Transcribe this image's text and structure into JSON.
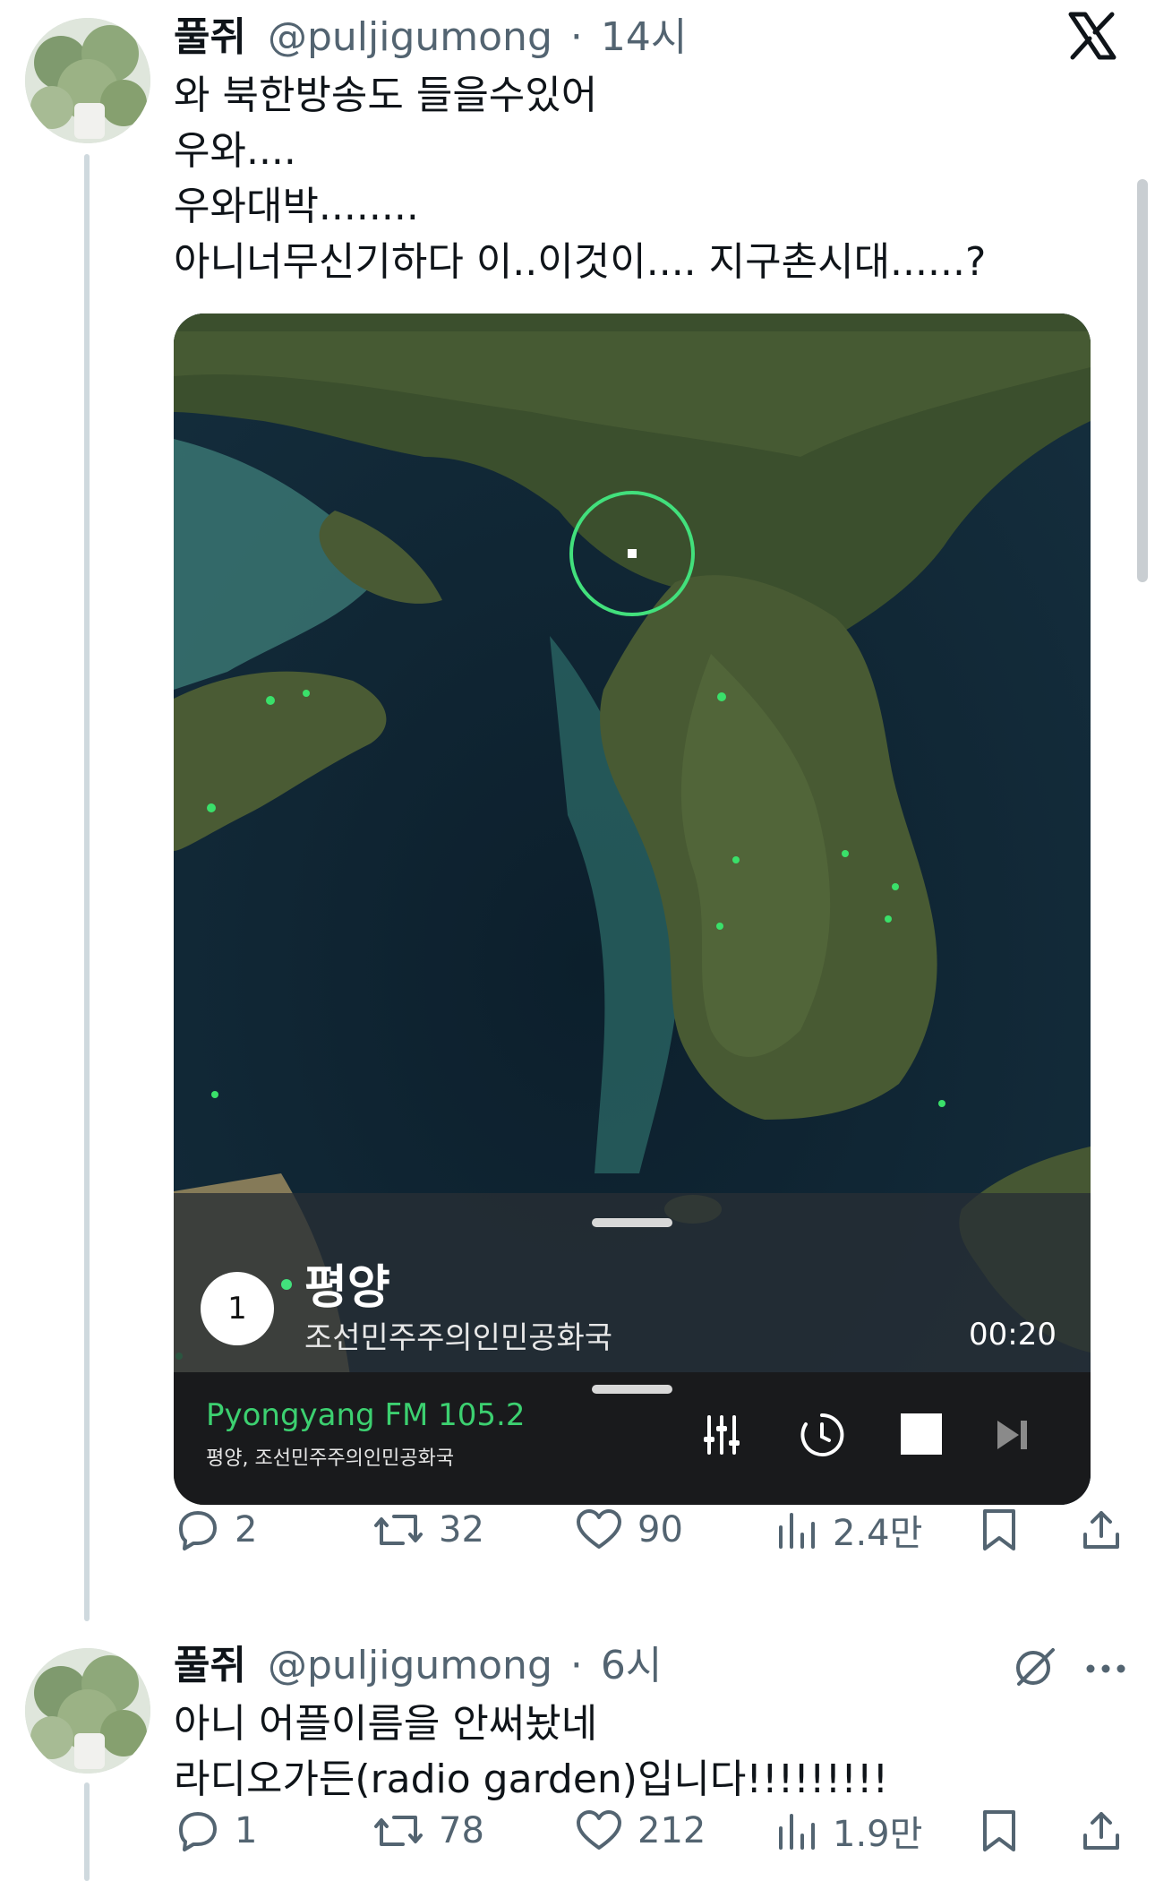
{
  "tweet1": {
    "display_name": "풀쥐",
    "handle": "@puljigumong",
    "separator": "·",
    "time": "14시",
    "lines": [
      "와 북한방송도 들을수있어",
      "우와....",
      "우와대박........",
      "아니너무신기하다 이..이것이.... 지구촌시대......?"
    ],
    "media": {
      "badge": "1",
      "station_title": "평양",
      "station_country": "조선민주주의인민공화국",
      "elapsed": "00:20",
      "now_playing": "Pyongyang FM 105.2",
      "now_playing_sub": "평양, 조선민주주의인민공화국"
    },
    "actions": {
      "replies": "2",
      "retweets": "32",
      "likes": "90",
      "views": "2.4만"
    }
  },
  "tweet2": {
    "display_name": "풀쥐",
    "handle": "@puljigumong",
    "separator": "·",
    "time": "6시",
    "lines": [
      "아니 어플이름을 안써놨네",
      "라디오가든(radio garden)입니다!!!!!!!!!"
    ],
    "actions": {
      "replies": "1",
      "retweets": "78",
      "likes": "212",
      "views": "1.9만"
    }
  },
  "colors": {
    "text": "#0f1419",
    "meta": "#536471",
    "accent_green": "#3cd070",
    "thread_line": "#cfd9de"
  },
  "icons": [
    "x-logo-icon",
    "reply-icon",
    "retweet-icon",
    "like-icon",
    "views-icon",
    "bookmark-icon",
    "share-icon",
    "grok-icon",
    "more-icon",
    "equalizer-icon",
    "timer-icon",
    "stop-icon",
    "next-icon"
  ]
}
